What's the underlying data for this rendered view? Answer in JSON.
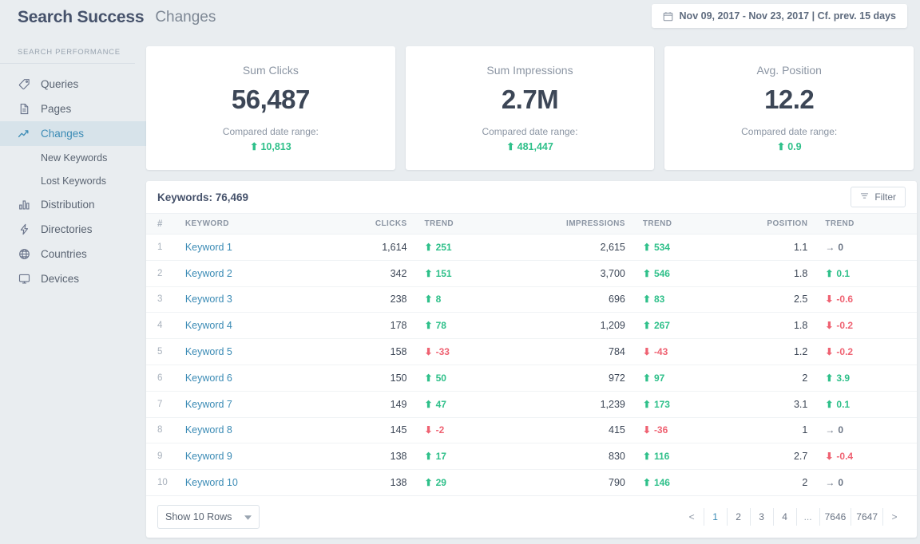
{
  "header": {
    "brand": "Search Success",
    "page_title": "Changes",
    "date_range": "Nov 09, 2017 - Nov 23, 2017 | Cf. prev. 15 days",
    "calendar_icon": "calendar-icon"
  },
  "sidebar": {
    "section_label": "SEARCH PERFORMANCE",
    "items": [
      {
        "label": "Queries",
        "icon": "tag-icon",
        "active": false
      },
      {
        "label": "Pages",
        "icon": "document-icon",
        "active": false
      },
      {
        "label": "Changes",
        "icon": "trendline-icon",
        "active": true
      },
      {
        "label": "Distribution",
        "icon": "bar-chart-icon",
        "active": false
      },
      {
        "label": "Directories",
        "icon": "bolt-icon",
        "active": false
      },
      {
        "label": "Countries",
        "icon": "globe-icon",
        "active": false
      },
      {
        "label": "Devices",
        "icon": "monitor-icon",
        "active": false
      }
    ],
    "sub_items": [
      {
        "label": "New Keywords"
      },
      {
        "label": "Lost Keywords"
      }
    ]
  },
  "kpis": [
    {
      "title": "Sum Clicks",
      "value": "56,487",
      "compare_label": "Compared date range:",
      "delta": "10,813",
      "direction": "up"
    },
    {
      "title": "Sum Impressions",
      "value": "2.7M",
      "compare_label": "Compared date range:",
      "delta": "481,447",
      "direction": "up"
    },
    {
      "title": "Avg. Position",
      "value": "12.2",
      "compare_label": "Compared date range:",
      "delta": "0.9",
      "direction": "up"
    }
  ],
  "table": {
    "title": "Keywords: 76,469",
    "filter_label": "Filter",
    "filter_icon": "filter-icon",
    "columns": [
      "#",
      "KEYWORD",
      "CLICKS",
      "TREND",
      "IMPRESSIONS",
      "TREND",
      "POSITION",
      "TREND"
    ],
    "rows": [
      {
        "idx": "1",
        "keyword": "Keyword 1",
        "clicks": "1,614",
        "clicks_trend": "251",
        "clicks_dir": "up",
        "impressions": "2,615",
        "impr_trend": "534",
        "impr_dir": "up",
        "position": "1.1",
        "pos_trend": "0",
        "pos_dir": "flat"
      },
      {
        "idx": "2",
        "keyword": "Keyword 2",
        "clicks": "342",
        "clicks_trend": "151",
        "clicks_dir": "up",
        "impressions": "3,700",
        "impr_trend": "546",
        "impr_dir": "up",
        "position": "1.8",
        "pos_trend": "0.1",
        "pos_dir": "up"
      },
      {
        "idx": "3",
        "keyword": "Keyword 3",
        "clicks": "238",
        "clicks_trend": "8",
        "clicks_dir": "up",
        "impressions": "696",
        "impr_trend": "83",
        "impr_dir": "up",
        "position": "2.5",
        "pos_trend": "-0.6",
        "pos_dir": "down"
      },
      {
        "idx": "4",
        "keyword": "Keyword 4",
        "clicks": "178",
        "clicks_trend": "78",
        "clicks_dir": "up",
        "impressions": "1,209",
        "impr_trend": "267",
        "impr_dir": "up",
        "position": "1.8",
        "pos_trend": "-0.2",
        "pos_dir": "down"
      },
      {
        "idx": "5",
        "keyword": "Keyword 5",
        "clicks": "158",
        "clicks_trend": "-33",
        "clicks_dir": "down",
        "impressions": "784",
        "impr_trend": "-43",
        "impr_dir": "down",
        "position": "1.2",
        "pos_trend": "-0.2",
        "pos_dir": "down"
      },
      {
        "idx": "6",
        "keyword": "Keyword 6",
        "clicks": "150",
        "clicks_trend": "50",
        "clicks_dir": "up",
        "impressions": "972",
        "impr_trend": "97",
        "impr_dir": "up",
        "position": "2",
        "pos_trend": "3.9",
        "pos_dir": "up"
      },
      {
        "idx": "7",
        "keyword": "Keyword 7",
        "clicks": "149",
        "clicks_trend": "47",
        "clicks_dir": "up",
        "impressions": "1,239",
        "impr_trend": "173",
        "impr_dir": "up",
        "position": "3.1",
        "pos_trend": "0.1",
        "pos_dir": "up"
      },
      {
        "idx": "8",
        "keyword": "Keyword 8",
        "clicks": "145",
        "clicks_trend": "-2",
        "clicks_dir": "down",
        "impressions": "415",
        "impr_trend": "-36",
        "impr_dir": "down",
        "position": "1",
        "pos_trend": "0",
        "pos_dir": "flat"
      },
      {
        "idx": "9",
        "keyword": "Keyword 9",
        "clicks": "138",
        "clicks_trend": "17",
        "clicks_dir": "up",
        "impressions": "830",
        "impr_trend": "116",
        "impr_dir": "up",
        "position": "2.7",
        "pos_trend": "-0.4",
        "pos_dir": "down"
      },
      {
        "idx": "10",
        "keyword": "Keyword 10",
        "clicks": "138",
        "clicks_trend": "29",
        "clicks_dir": "up",
        "impressions": "790",
        "impr_trend": "146",
        "impr_dir": "up",
        "position": "2",
        "pos_trend": "0",
        "pos_dir": "flat"
      }
    ],
    "rows_selector": "Show 10 Rows",
    "pagination": {
      "prev": "<",
      "next": ">",
      "ellipsis": "...",
      "pages": [
        "1",
        "2",
        "3",
        "4"
      ],
      "tail_pages": [
        "7646",
        "7647"
      ],
      "active": "1"
    }
  },
  "colors": {
    "accent": "#3b8bb5",
    "up": "#2fc08a",
    "down": "#ef6272",
    "flat": "#6b7585",
    "background": "#e9edf0"
  }
}
